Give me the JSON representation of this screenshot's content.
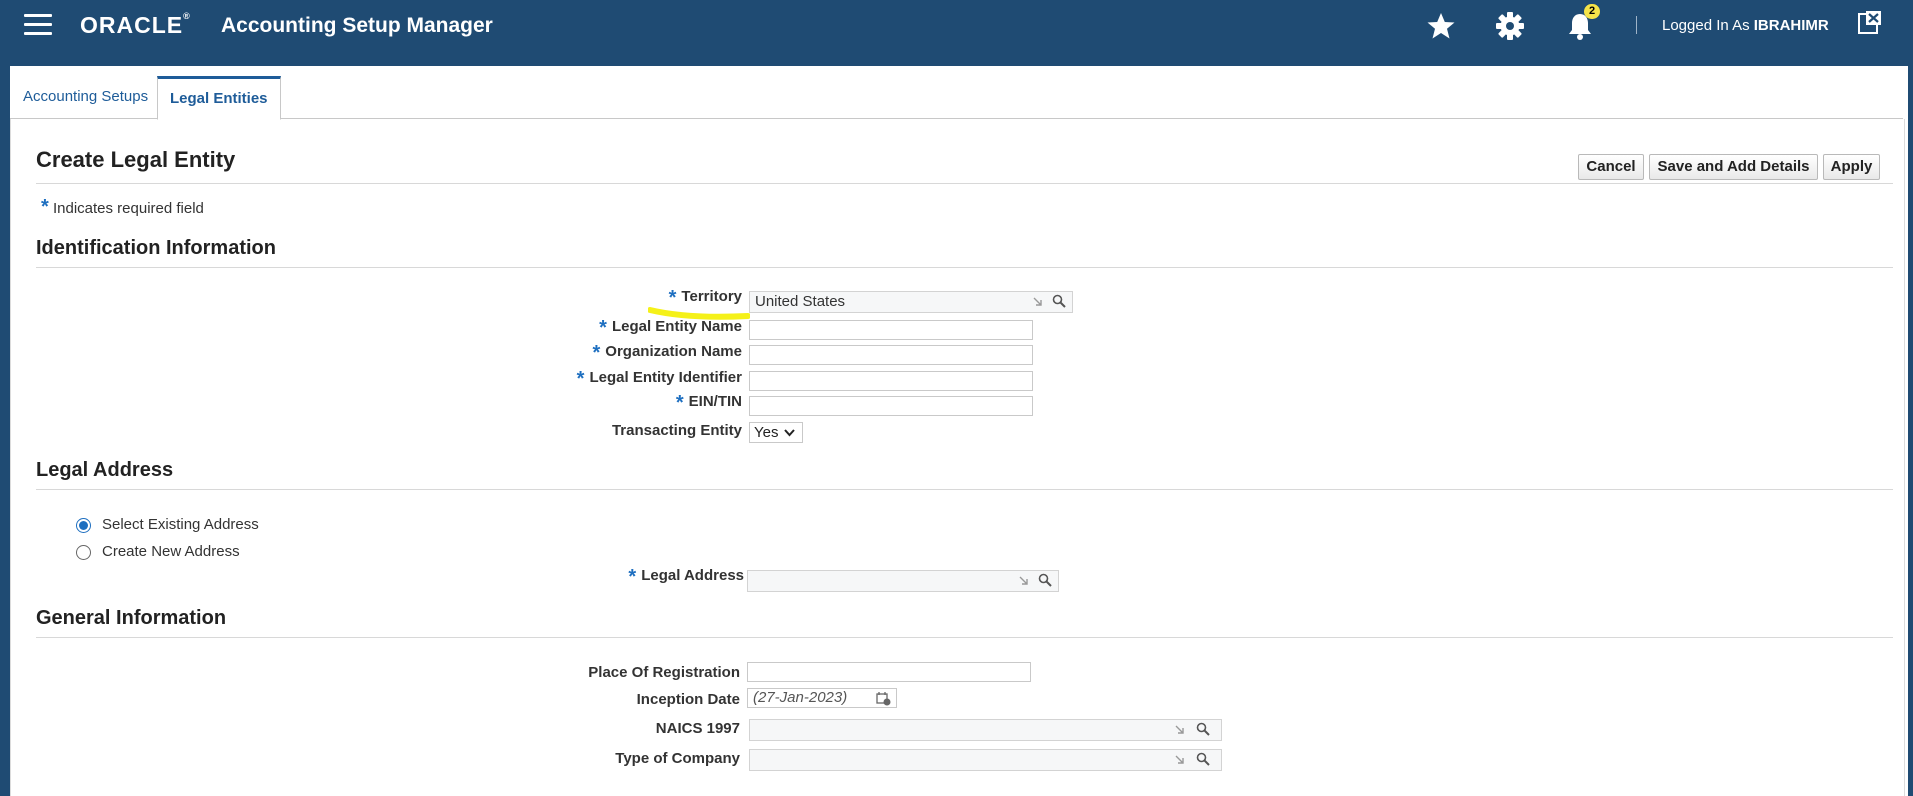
{
  "header": {
    "brand": "ORACLE",
    "app_title": "Accounting Setup Manager",
    "notification_count": "2",
    "logged_in_prefix": "Logged In As",
    "user": "IBRAHIMR",
    "colors": {
      "header_bg": "#1f4b73",
      "badge": "#f5e44a",
      "link": "#1e5c99",
      "required_star": "#1e6fc0",
      "highlight": "#f4f000"
    },
    "icons": [
      "menu-icon",
      "star-icon",
      "gear-icon",
      "bell-icon",
      "close-window-icon"
    ]
  },
  "tabs": [
    {
      "label": "Accounting Setups",
      "active": false
    },
    {
      "label": "Legal Entities",
      "active": true
    }
  ],
  "page": {
    "title": "Create Legal Entity",
    "required_note": "Indicates required field",
    "buttons": {
      "cancel": "Cancel",
      "save_add": "Save and Add Details",
      "apply": "Apply"
    }
  },
  "identification": {
    "title": "Identification Information",
    "territory_label": "Territory",
    "territory_value": "United States",
    "legal_entity_name_label": "Legal Entity Name",
    "legal_entity_name_value": "",
    "organization_name_label": "Organization Name",
    "organization_name_value": "",
    "legal_entity_identifier_label": "Legal Entity Identifier",
    "legal_entity_identifier_value": "",
    "ein_label": "EIN/TIN",
    "ein_value": "",
    "transacting_label": "Transacting Entity",
    "transacting_value": "Yes"
  },
  "legal_address": {
    "title": "Legal Address",
    "option_existing": "Select Existing Address",
    "option_new": "Create New Address",
    "selected": "existing",
    "legal_address_label": "Legal Address",
    "legal_address_value": ""
  },
  "general": {
    "title": "General Information",
    "place_label": "Place Of Registration",
    "place_value": "",
    "inception_label": "Inception Date",
    "inception_placeholder": "(27-Jan-2023)",
    "naics_label": "NAICS 1997",
    "naics_value": "",
    "type_label": "Type of Company",
    "type_value": ""
  }
}
